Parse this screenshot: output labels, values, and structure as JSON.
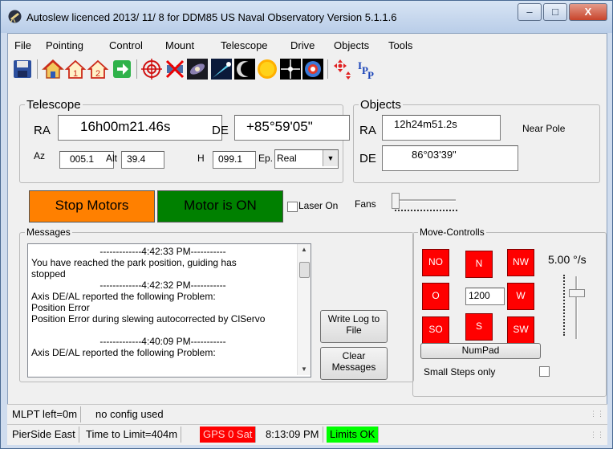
{
  "window": {
    "title": "Autoslew licenced  2013/ 11/ 8 for DDM85 US Naval Observatory Version 5.1.1.6",
    "minimize": "–",
    "maximize": "□",
    "close": "X"
  },
  "menu": [
    "File",
    "Pointing",
    "Control",
    "Mount",
    "Telescope",
    "Drive",
    "Objects",
    "Tools"
  ],
  "toolbar": {
    "icons": [
      "save-icon",
      "home-park-icon",
      "park-1-icon",
      "park-2-icon",
      "go-arrow-icon",
      "target-crosshair-icon",
      "satellite-off-icon",
      "galaxy-icon",
      "comet-icon",
      "moon-icon",
      "sun-icon",
      "star-icon",
      "planet-icon",
      "directions-icon",
      "app-logo-icon"
    ]
  },
  "telescope": {
    "legend": "Telescope",
    "ra_label": "RA",
    "ra_value": "16h00m21.46s",
    "de_label": "DE",
    "de_value": "+85°59'05\"",
    "az_label": "Az",
    "az_value": "005.1",
    "alt_label": "Alt",
    "alt_value": "39.4",
    "h_label": "H",
    "h_value": "099.1",
    "ep_label": "Ep.",
    "ep_value": "Real"
  },
  "objects": {
    "legend": "Objects",
    "ra_label": "RA",
    "ra_value": "12h24m51.2s",
    "de_label": "DE",
    "de_value": "86°03'39\"",
    "note": "Near Pole"
  },
  "controls": {
    "stop_motors": "Stop Motors",
    "motor_status": "Motor is ON",
    "laser_label": "Laser On",
    "laser_checked": false,
    "fans_label": "Fans",
    "fans_level": 0
  },
  "messages": {
    "legend": "Messages",
    "lines": [
      {
        "text": "-------------4:42:33 PM-----------",
        "center": true
      },
      {
        "text": "You have reached the park position, guiding has",
        "center": false
      },
      {
        "text": "stopped",
        "center": false
      },
      {
        "text": "-------------4:42:32 PM-----------",
        "center": true
      },
      {
        "text": "Axis DE/AL reported the following Problem:",
        "center": false
      },
      {
        "text": "Position Error",
        "center": false
      },
      {
        "text": "Position Error during slewing autocorrected by ClServo",
        "center": false
      },
      {
        "text": "",
        "center": false
      },
      {
        "text": "-------------4:40:09 PM-----------",
        "center": true
      },
      {
        "text": "Axis DE/AL reported the following Problem:",
        "center": false
      }
    ],
    "write_log_line1": "Write Log to",
    "write_log_line2": "File",
    "clear_line1": "Clear",
    "clear_line2": "Messages"
  },
  "move": {
    "legend": "Move-Controlls",
    "no": "NO",
    "n": "N",
    "nw": "NW",
    "o": "O",
    "w": "W",
    "so": "SO",
    "s": "S",
    "sw": "SW",
    "speed_value": "1200",
    "rate": "5.00 °/s",
    "numpad": "NumPad",
    "small_steps": "Small Steps only",
    "small_steps_checked": false
  },
  "status1": {
    "mlpt": "MLPT left=0m",
    "config": "no config used"
  },
  "status2": {
    "pierside": "PierSide East",
    "time_limit": "Time to Limit=404m",
    "gps": "GPS 0 Sat",
    "time": "8:13:09 PM",
    "limits": "Limits OK"
  },
  "colors": {
    "stop_button": "#ff8000",
    "motor_on": "#008000",
    "direction_button": "#ff0000",
    "gps_bad": "#ff0000",
    "limits_ok": "#00ff00"
  }
}
